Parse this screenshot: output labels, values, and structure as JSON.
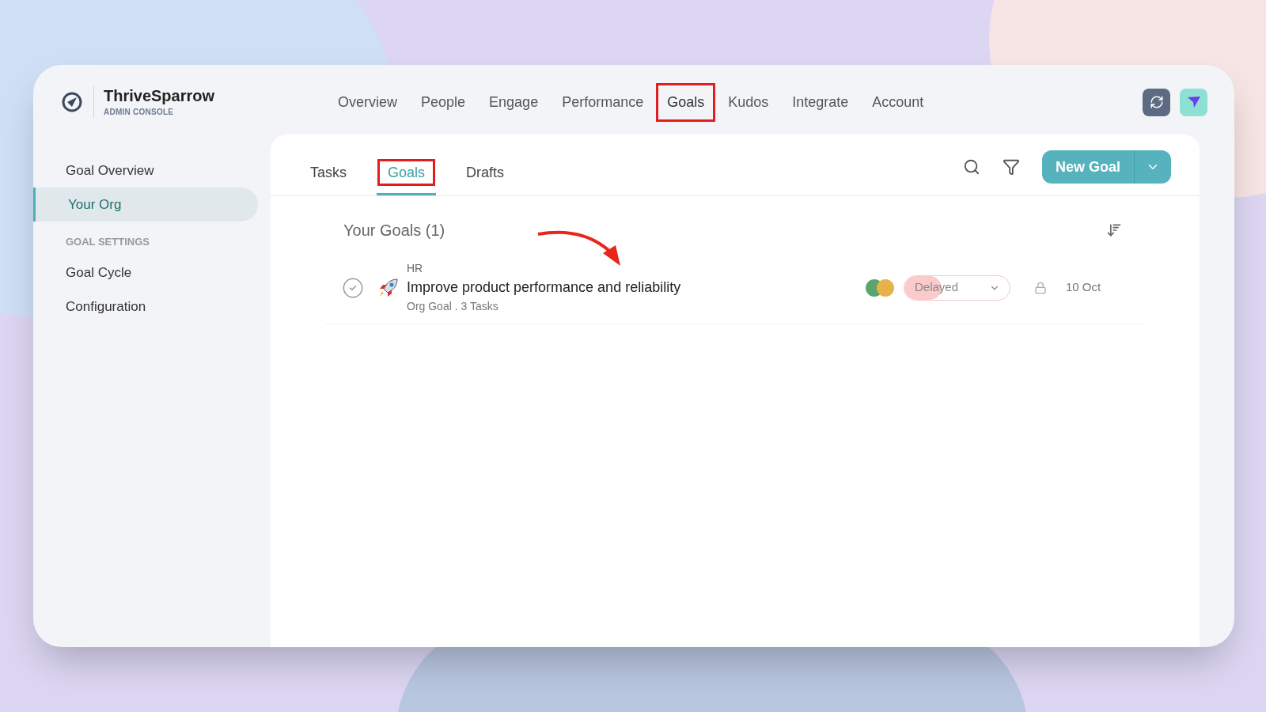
{
  "brand": {
    "name": "ThriveSparrow",
    "subtitle": "ADMIN CONSOLE"
  },
  "nav": [
    {
      "label": "Overview",
      "selected": false,
      "highlighted": false
    },
    {
      "label": "People",
      "selected": false,
      "highlighted": false
    },
    {
      "label": "Engage",
      "selected": false,
      "highlighted": false
    },
    {
      "label": "Performance",
      "selected": false,
      "highlighted": false
    },
    {
      "label": "Goals",
      "selected": true,
      "highlighted": true
    },
    {
      "label": "Kudos",
      "selected": false,
      "highlighted": false
    },
    {
      "label": "Integrate",
      "selected": false,
      "highlighted": false
    },
    {
      "label": "Account",
      "selected": false,
      "highlighted": false
    }
  ],
  "sidebar": {
    "items": [
      {
        "kind": "item",
        "label": "Goal Overview",
        "selected": false
      },
      {
        "kind": "item",
        "label": "Your Org",
        "selected": true
      },
      {
        "kind": "heading",
        "label": "GOAL SETTINGS"
      },
      {
        "kind": "item",
        "label": "Goal Cycle",
        "selected": false
      },
      {
        "kind": "item",
        "label": "Configuration",
        "selected": false
      }
    ]
  },
  "tabs": [
    {
      "label": "Tasks",
      "selected": false,
      "highlighted": false
    },
    {
      "label": "Goals",
      "selected": true,
      "highlighted": true
    },
    {
      "label": "Drafts",
      "selected": false,
      "highlighted": false
    }
  ],
  "new_goal_button": "New Goal",
  "list_title": "Your Goals (1)",
  "goals": [
    {
      "department": "HR",
      "title": "Improve product performance and reliability",
      "meta": "Org Goal . 3 Tasks",
      "done": false,
      "status": "Delayed",
      "level": 0.35,
      "due": "10 Oct"
    }
  ]
}
